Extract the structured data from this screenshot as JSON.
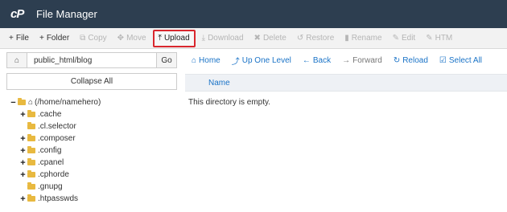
{
  "app": {
    "title": "File Manager",
    "logo": "cP"
  },
  "toolbar": {
    "items": [
      {
        "label": "File",
        "icon": "plus-icon",
        "glyph": "+",
        "enabled": true
      },
      {
        "label": "Folder",
        "icon": "plus-icon",
        "glyph": "+",
        "enabled": true
      },
      {
        "label": "Copy",
        "icon": "copy-icon",
        "glyph": "⧉",
        "enabled": false
      },
      {
        "label": "Move",
        "icon": "move-icon",
        "glyph": "✥",
        "enabled": false
      },
      {
        "label": "Upload",
        "icon": "upload-icon",
        "glyph": "⤒",
        "enabled": true,
        "highlighted": true
      },
      {
        "label": "Download",
        "icon": "download-icon",
        "glyph": "⤓",
        "enabled": false
      },
      {
        "label": "Delete",
        "icon": "delete-icon",
        "glyph": "✖",
        "enabled": false
      },
      {
        "label": "Restore",
        "icon": "restore-icon",
        "glyph": "↺",
        "enabled": false
      },
      {
        "label": "Rename",
        "icon": "rename-icon",
        "glyph": "▮",
        "enabled": false
      },
      {
        "label": "Edit",
        "icon": "edit-icon",
        "glyph": "✎",
        "enabled": false
      },
      {
        "label": "HTM",
        "icon": "html-editor-icon",
        "glyph": "✎",
        "enabled": false
      }
    ]
  },
  "sidebar": {
    "path_value": "public_html/blog",
    "go_label": "Go",
    "collapse_label": "Collapse All",
    "root_label": "(/home/namehero)",
    "folders": [
      {
        "label": ".cache",
        "expandable": true
      },
      {
        "label": ".cl.selector",
        "expandable": false
      },
      {
        "label": ".composer",
        "expandable": true
      },
      {
        "label": ".config",
        "expandable": true
      },
      {
        "label": ".cpanel",
        "expandable": true
      },
      {
        "label": ".cphorde",
        "expandable": true
      },
      {
        "label": ".gnupg",
        "expandable": false
      },
      {
        "label": ".htpasswds",
        "expandable": true
      }
    ]
  },
  "nav": {
    "items": [
      {
        "label": "Home",
        "glyph": "⌂",
        "enabled": true
      },
      {
        "label": "Up One Level",
        "glyph": "⤴",
        "enabled": true
      },
      {
        "label": "Back",
        "glyph": "←",
        "enabled": true
      },
      {
        "label": "Forward",
        "glyph": "→",
        "enabled": false
      },
      {
        "label": "Reload",
        "glyph": "↻",
        "enabled": true
      },
      {
        "label": "Select All",
        "glyph": "☑",
        "enabled": true
      }
    ]
  },
  "listing": {
    "column_name": "Name",
    "empty_message": "This directory is empty."
  },
  "colors": {
    "titlebar": "#2d3e50",
    "accent": "#1a73c7",
    "highlight_border": "#d9272e",
    "folder": "#e8b940"
  }
}
